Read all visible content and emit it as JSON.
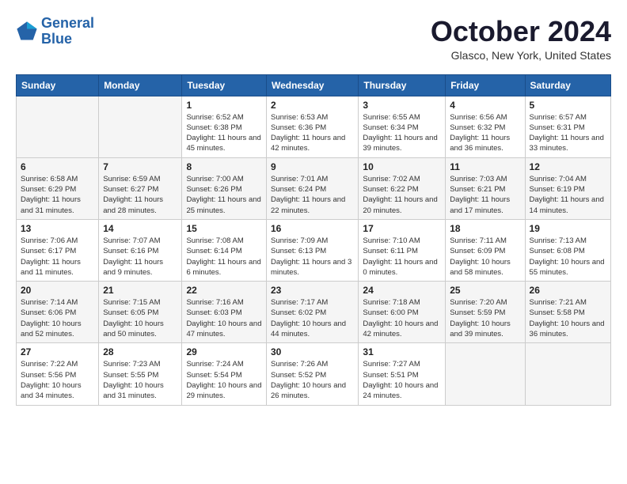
{
  "header": {
    "logo_line1": "General",
    "logo_line2": "Blue",
    "month": "October 2024",
    "location": "Glasco, New York, United States"
  },
  "weekdays": [
    "Sunday",
    "Monday",
    "Tuesday",
    "Wednesday",
    "Thursday",
    "Friday",
    "Saturday"
  ],
  "weeks": [
    [
      {
        "day": "",
        "sunrise": "",
        "sunset": "",
        "daylight": ""
      },
      {
        "day": "",
        "sunrise": "",
        "sunset": "",
        "daylight": ""
      },
      {
        "day": "1",
        "sunrise": "Sunrise: 6:52 AM",
        "sunset": "Sunset: 6:38 PM",
        "daylight": "Daylight: 11 hours and 45 minutes."
      },
      {
        "day": "2",
        "sunrise": "Sunrise: 6:53 AM",
        "sunset": "Sunset: 6:36 PM",
        "daylight": "Daylight: 11 hours and 42 minutes."
      },
      {
        "day": "3",
        "sunrise": "Sunrise: 6:55 AM",
        "sunset": "Sunset: 6:34 PM",
        "daylight": "Daylight: 11 hours and 39 minutes."
      },
      {
        "day": "4",
        "sunrise": "Sunrise: 6:56 AM",
        "sunset": "Sunset: 6:32 PM",
        "daylight": "Daylight: 11 hours and 36 minutes."
      },
      {
        "day": "5",
        "sunrise": "Sunrise: 6:57 AM",
        "sunset": "Sunset: 6:31 PM",
        "daylight": "Daylight: 11 hours and 33 minutes."
      }
    ],
    [
      {
        "day": "6",
        "sunrise": "Sunrise: 6:58 AM",
        "sunset": "Sunset: 6:29 PM",
        "daylight": "Daylight: 11 hours and 31 minutes."
      },
      {
        "day": "7",
        "sunrise": "Sunrise: 6:59 AM",
        "sunset": "Sunset: 6:27 PM",
        "daylight": "Daylight: 11 hours and 28 minutes."
      },
      {
        "day": "8",
        "sunrise": "Sunrise: 7:00 AM",
        "sunset": "Sunset: 6:26 PM",
        "daylight": "Daylight: 11 hours and 25 minutes."
      },
      {
        "day": "9",
        "sunrise": "Sunrise: 7:01 AM",
        "sunset": "Sunset: 6:24 PM",
        "daylight": "Daylight: 11 hours and 22 minutes."
      },
      {
        "day": "10",
        "sunrise": "Sunrise: 7:02 AM",
        "sunset": "Sunset: 6:22 PM",
        "daylight": "Daylight: 11 hours and 20 minutes."
      },
      {
        "day": "11",
        "sunrise": "Sunrise: 7:03 AM",
        "sunset": "Sunset: 6:21 PM",
        "daylight": "Daylight: 11 hours and 17 minutes."
      },
      {
        "day": "12",
        "sunrise": "Sunrise: 7:04 AM",
        "sunset": "Sunset: 6:19 PM",
        "daylight": "Daylight: 11 hours and 14 minutes."
      }
    ],
    [
      {
        "day": "13",
        "sunrise": "Sunrise: 7:06 AM",
        "sunset": "Sunset: 6:17 PM",
        "daylight": "Daylight: 11 hours and 11 minutes."
      },
      {
        "day": "14",
        "sunrise": "Sunrise: 7:07 AM",
        "sunset": "Sunset: 6:16 PM",
        "daylight": "Daylight: 11 hours and 9 minutes."
      },
      {
        "day": "15",
        "sunrise": "Sunrise: 7:08 AM",
        "sunset": "Sunset: 6:14 PM",
        "daylight": "Daylight: 11 hours and 6 minutes."
      },
      {
        "day": "16",
        "sunrise": "Sunrise: 7:09 AM",
        "sunset": "Sunset: 6:13 PM",
        "daylight": "Daylight: 11 hours and 3 minutes."
      },
      {
        "day": "17",
        "sunrise": "Sunrise: 7:10 AM",
        "sunset": "Sunset: 6:11 PM",
        "daylight": "Daylight: 11 hours and 0 minutes."
      },
      {
        "day": "18",
        "sunrise": "Sunrise: 7:11 AM",
        "sunset": "Sunset: 6:09 PM",
        "daylight": "Daylight: 10 hours and 58 minutes."
      },
      {
        "day": "19",
        "sunrise": "Sunrise: 7:13 AM",
        "sunset": "Sunset: 6:08 PM",
        "daylight": "Daylight: 10 hours and 55 minutes."
      }
    ],
    [
      {
        "day": "20",
        "sunrise": "Sunrise: 7:14 AM",
        "sunset": "Sunset: 6:06 PM",
        "daylight": "Daylight: 10 hours and 52 minutes."
      },
      {
        "day": "21",
        "sunrise": "Sunrise: 7:15 AM",
        "sunset": "Sunset: 6:05 PM",
        "daylight": "Daylight: 10 hours and 50 minutes."
      },
      {
        "day": "22",
        "sunrise": "Sunrise: 7:16 AM",
        "sunset": "Sunset: 6:03 PM",
        "daylight": "Daylight: 10 hours and 47 minutes."
      },
      {
        "day": "23",
        "sunrise": "Sunrise: 7:17 AM",
        "sunset": "Sunset: 6:02 PM",
        "daylight": "Daylight: 10 hours and 44 minutes."
      },
      {
        "day": "24",
        "sunrise": "Sunrise: 7:18 AM",
        "sunset": "Sunset: 6:00 PM",
        "daylight": "Daylight: 10 hours and 42 minutes."
      },
      {
        "day": "25",
        "sunrise": "Sunrise: 7:20 AM",
        "sunset": "Sunset: 5:59 PM",
        "daylight": "Daylight: 10 hours and 39 minutes."
      },
      {
        "day": "26",
        "sunrise": "Sunrise: 7:21 AM",
        "sunset": "Sunset: 5:58 PM",
        "daylight": "Daylight: 10 hours and 36 minutes."
      }
    ],
    [
      {
        "day": "27",
        "sunrise": "Sunrise: 7:22 AM",
        "sunset": "Sunset: 5:56 PM",
        "daylight": "Daylight: 10 hours and 34 minutes."
      },
      {
        "day": "28",
        "sunrise": "Sunrise: 7:23 AM",
        "sunset": "Sunset: 5:55 PM",
        "daylight": "Daylight: 10 hours and 31 minutes."
      },
      {
        "day": "29",
        "sunrise": "Sunrise: 7:24 AM",
        "sunset": "Sunset: 5:54 PM",
        "daylight": "Daylight: 10 hours and 29 minutes."
      },
      {
        "day": "30",
        "sunrise": "Sunrise: 7:26 AM",
        "sunset": "Sunset: 5:52 PM",
        "daylight": "Daylight: 10 hours and 26 minutes."
      },
      {
        "day": "31",
        "sunrise": "Sunrise: 7:27 AM",
        "sunset": "Sunset: 5:51 PM",
        "daylight": "Daylight: 10 hours and 24 minutes."
      },
      {
        "day": "",
        "sunrise": "",
        "sunset": "",
        "daylight": ""
      },
      {
        "day": "",
        "sunrise": "",
        "sunset": "",
        "daylight": ""
      }
    ]
  ]
}
